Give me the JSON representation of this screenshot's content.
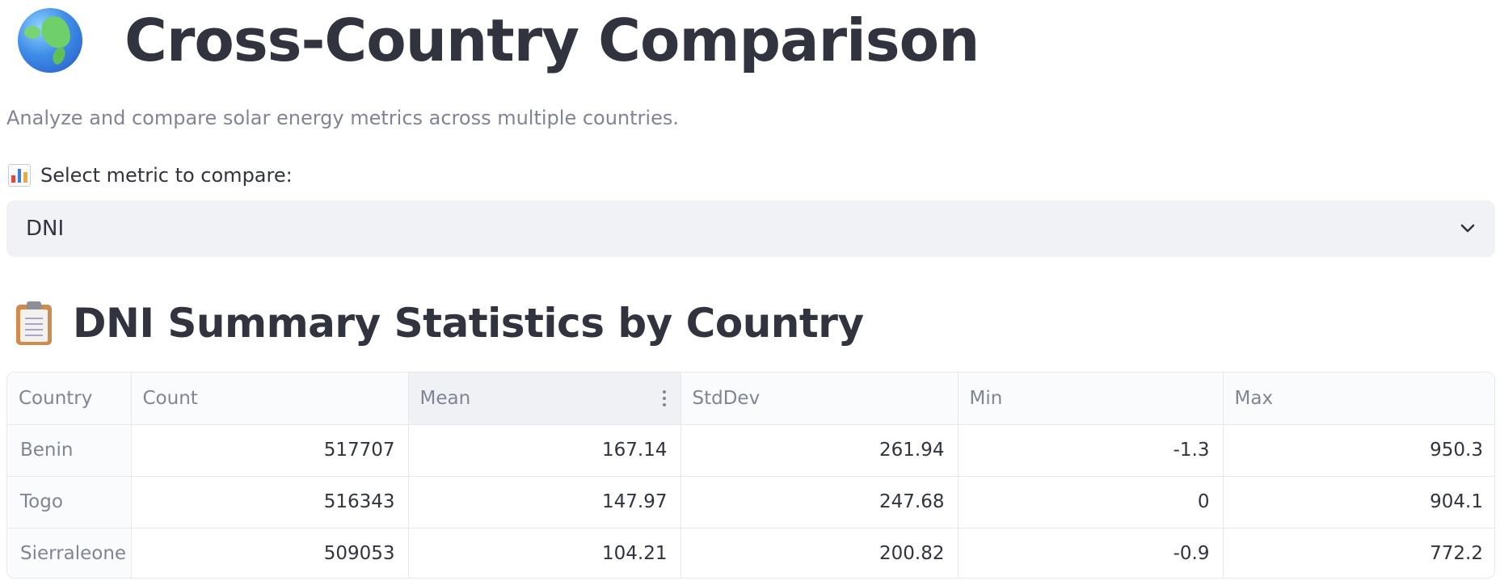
{
  "header": {
    "title": "Cross-Country Comparison",
    "title_icon": "globe-europe-africa-icon",
    "subtitle": "Analyze and compare solar energy metrics across multiple countries."
  },
  "metric_select": {
    "label": "Select metric to compare:",
    "label_icon": "bar-chart-icon",
    "selected": "DNI",
    "chevron_icon": "chevron-down-icon"
  },
  "summary": {
    "title": "DNI Summary Statistics by Country",
    "title_icon": "clipboard-icon",
    "columns": [
      "Country",
      "Count",
      "Mean",
      "StdDev",
      "Min",
      "Max"
    ],
    "rows": [
      [
        "Benin",
        "517707",
        "167.14",
        "261.94",
        "-1.3",
        "950.3"
      ],
      [
        "Togo",
        "516343",
        "147.97",
        "247.68",
        "0",
        "904.1"
      ],
      [
        "Sierraleone",
        "509053",
        "104.21",
        "200.82",
        "-0.9",
        "772.2"
      ]
    ]
  }
}
